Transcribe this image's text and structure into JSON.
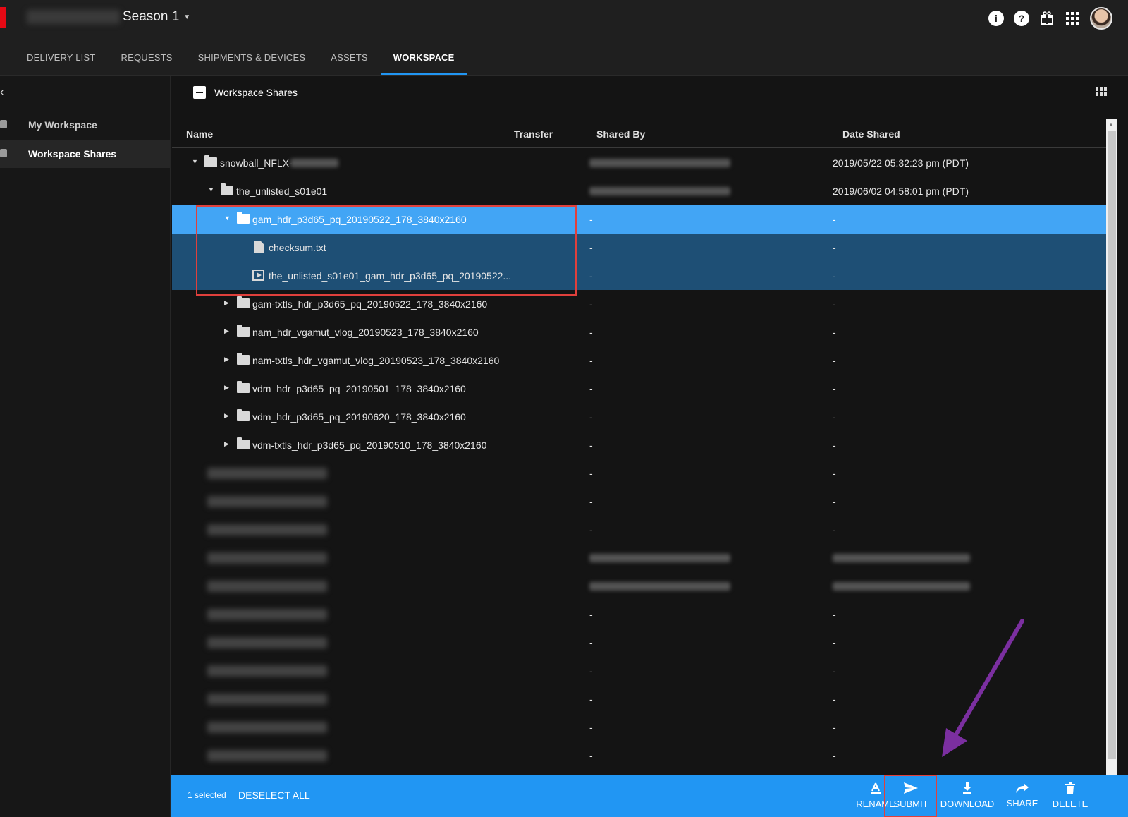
{
  "header": {
    "season_title": "Season 1",
    "tabs": [
      "DELIVERY LIST",
      "REQUESTS",
      "SHIPMENTS & DEVICES",
      "ASSETS",
      "WORKSPACE"
    ],
    "active_tab": "WORKSPACE",
    "icons": [
      "info-icon",
      "help-icon",
      "gift-icon",
      "apps-grid-icon"
    ]
  },
  "sidebar": {
    "items": [
      {
        "label": "My Workspace",
        "icon": "folder-icon"
      },
      {
        "label": "Workspace Shares",
        "icon": "shared-folder-icon"
      }
    ],
    "active": "Workspace Shares"
  },
  "panel": {
    "title": "Workspace Shares"
  },
  "table": {
    "columns": [
      "Name",
      "Transfer",
      "Shared By",
      "Date Shared"
    ],
    "rows": [
      {
        "name": "snowball_NFLX-",
        "shared_by": "",
        "date": "2019/05/22 05:32:23 pm (PDT)"
      },
      {
        "name": "the_unlisted_s01e01",
        "shared_by": "",
        "date": "2019/06/02 04:58:01 pm (PDT)"
      },
      {
        "name": "gam_hdr_p3d65_pq_20190522_178_3840x2160",
        "shared_by": "-",
        "date": "-"
      },
      {
        "name": "checksum.txt",
        "shared_by": "-",
        "date": "-"
      },
      {
        "name": "the_unlisted_s01e01_gam_hdr_p3d65_pq_20190522...",
        "shared_by": "-",
        "date": "-"
      },
      {
        "name": "gam-txtls_hdr_p3d65_pq_20190522_178_3840x2160",
        "shared_by": "-",
        "date": "-"
      },
      {
        "name": "nam_hdr_vgamut_vlog_20190523_178_3840x2160",
        "shared_by": "-",
        "date": "-"
      },
      {
        "name": "nam-txtls_hdr_vgamut_vlog_20190523_178_3840x2160",
        "shared_by": "-",
        "date": "-"
      },
      {
        "name": "vdm_hdr_p3d65_pq_20190501_178_3840x2160",
        "shared_by": "-",
        "date": "-"
      },
      {
        "name": "vdm_hdr_p3d65_pq_20190620_178_3840x2160",
        "shared_by": "-",
        "date": "-"
      },
      {
        "name": "vdm-txtls_hdr_p3d65_pq_20190510_178_3840x2160",
        "shared_by": "-",
        "date": "-"
      },
      {
        "name": "",
        "shared_by": "-",
        "date": "-"
      },
      {
        "name": "",
        "shared_by": "-",
        "date": "-"
      },
      {
        "name": "",
        "shared_by": "-",
        "date": "-"
      },
      {
        "name": "",
        "shared_by": "",
        "date": ""
      },
      {
        "name": "",
        "shared_by": "",
        "date": ""
      },
      {
        "name": "",
        "shared_by": "-",
        "date": "-"
      },
      {
        "name": "",
        "shared_by": "-",
        "date": "-"
      },
      {
        "name": "",
        "shared_by": "-",
        "date": "-"
      },
      {
        "name": "",
        "shared_by": "-",
        "date": "-"
      },
      {
        "name": "",
        "shared_by": "-",
        "date": "-"
      },
      {
        "name": "",
        "shared_by": "-",
        "date": "-"
      }
    ]
  },
  "action_bar": {
    "selected_count": "1 selected",
    "deselect_label": "DESELECT ALL",
    "actions": [
      "RENAME",
      "SUBMIT",
      "DOWNLOAD",
      "SHARE",
      "DELETE"
    ]
  },
  "colors": {
    "accent": "#2196f3",
    "selected_row": "#42a5f5",
    "child_selected_row": "#1e4f75",
    "annotation_red": "#e0403c",
    "annotation_arrow": "#7b2fa0"
  }
}
